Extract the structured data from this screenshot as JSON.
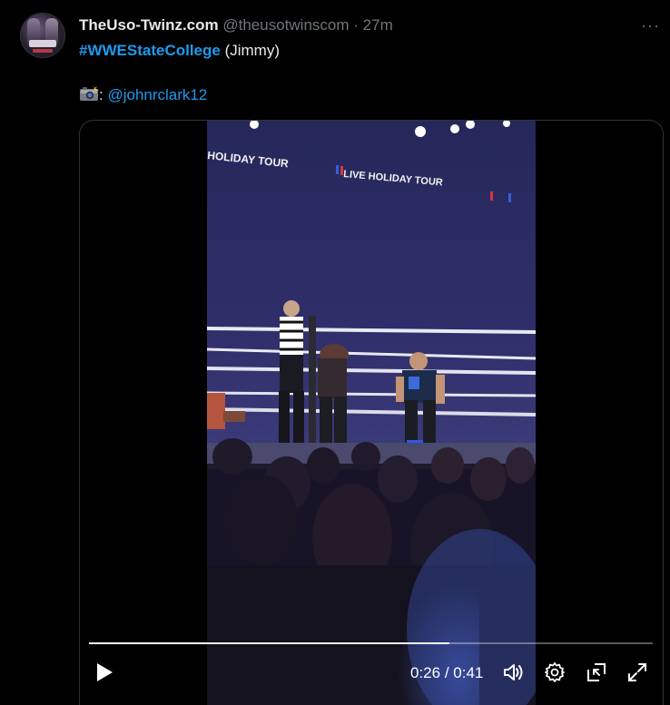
{
  "post": {
    "author": {
      "display_name": "TheUso-Twinz.com",
      "handle": "@theusotwinscom",
      "separator": "·",
      "time": "27m"
    },
    "more_glyph": "···",
    "text": {
      "hashtag": "#WWEStateCollege",
      "after_hashtag": " (Jimmy)",
      "camera_icon": "camera-flash-icon",
      "camera_suffix": ": ",
      "mention": "@johnrclark12"
    }
  },
  "video": {
    "banner_text": "WWE LIVE HOLIDAY TOUR",
    "progress_fraction": 0.64,
    "current_time": "0:26",
    "time_separator": " / ",
    "duration": "0:41",
    "controls": [
      "play-icon",
      "volume-icon",
      "settings-gear-icon",
      "picture-in-picture-icon",
      "fullscreen-icon"
    ]
  },
  "colors": {
    "accent": "#1d9bf0",
    "text": "#e7e9ea",
    "muted": "#71767b",
    "background": "#000000"
  }
}
